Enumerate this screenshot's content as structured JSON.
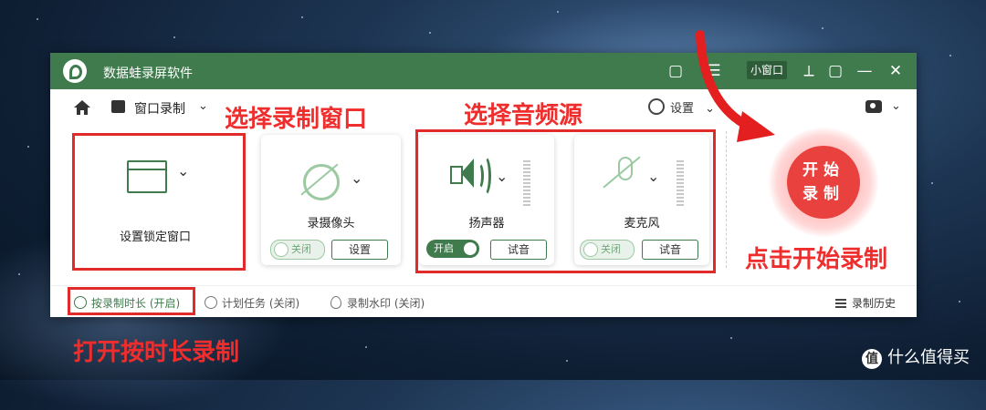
{
  "window": {
    "app_title": "数据蛙录屏软件",
    "mini_window_label": "小窗口"
  },
  "toolbar": {
    "mode_label": "窗口录制",
    "settings_label": "设置"
  },
  "cards": {
    "window": {
      "label": "设置锁定窗口"
    },
    "webcam": {
      "label": "录摄像头",
      "toggle_label": "关闭",
      "button_label": "设置"
    },
    "speaker": {
      "label": "扬声器",
      "toggle_label": "开启",
      "button_label": "试音"
    },
    "microphone": {
      "label": "麦克风",
      "toggle_label": "关闭",
      "button_label": "试音"
    }
  },
  "record": {
    "line1": "开始",
    "line2": "录制"
  },
  "bottom": {
    "timer_label": "按录制时长 (开启)",
    "schedule_label": "计划任务 (关闭)",
    "watermark_label": "录制水印 (关闭)",
    "history_label": "录制历史"
  },
  "annotations": {
    "select_window": "选择录制窗口",
    "select_audio": "选择音频源",
    "click_record": "点击开始录制",
    "timed_record": "打开按时长录制"
  },
  "watermark": {
    "badge": "值",
    "text": "什么值得买"
  },
  "colors": {
    "brand_green": "#3f7b4c",
    "annotation_red": "#ef2d2d",
    "record_red": "#e8413e"
  }
}
